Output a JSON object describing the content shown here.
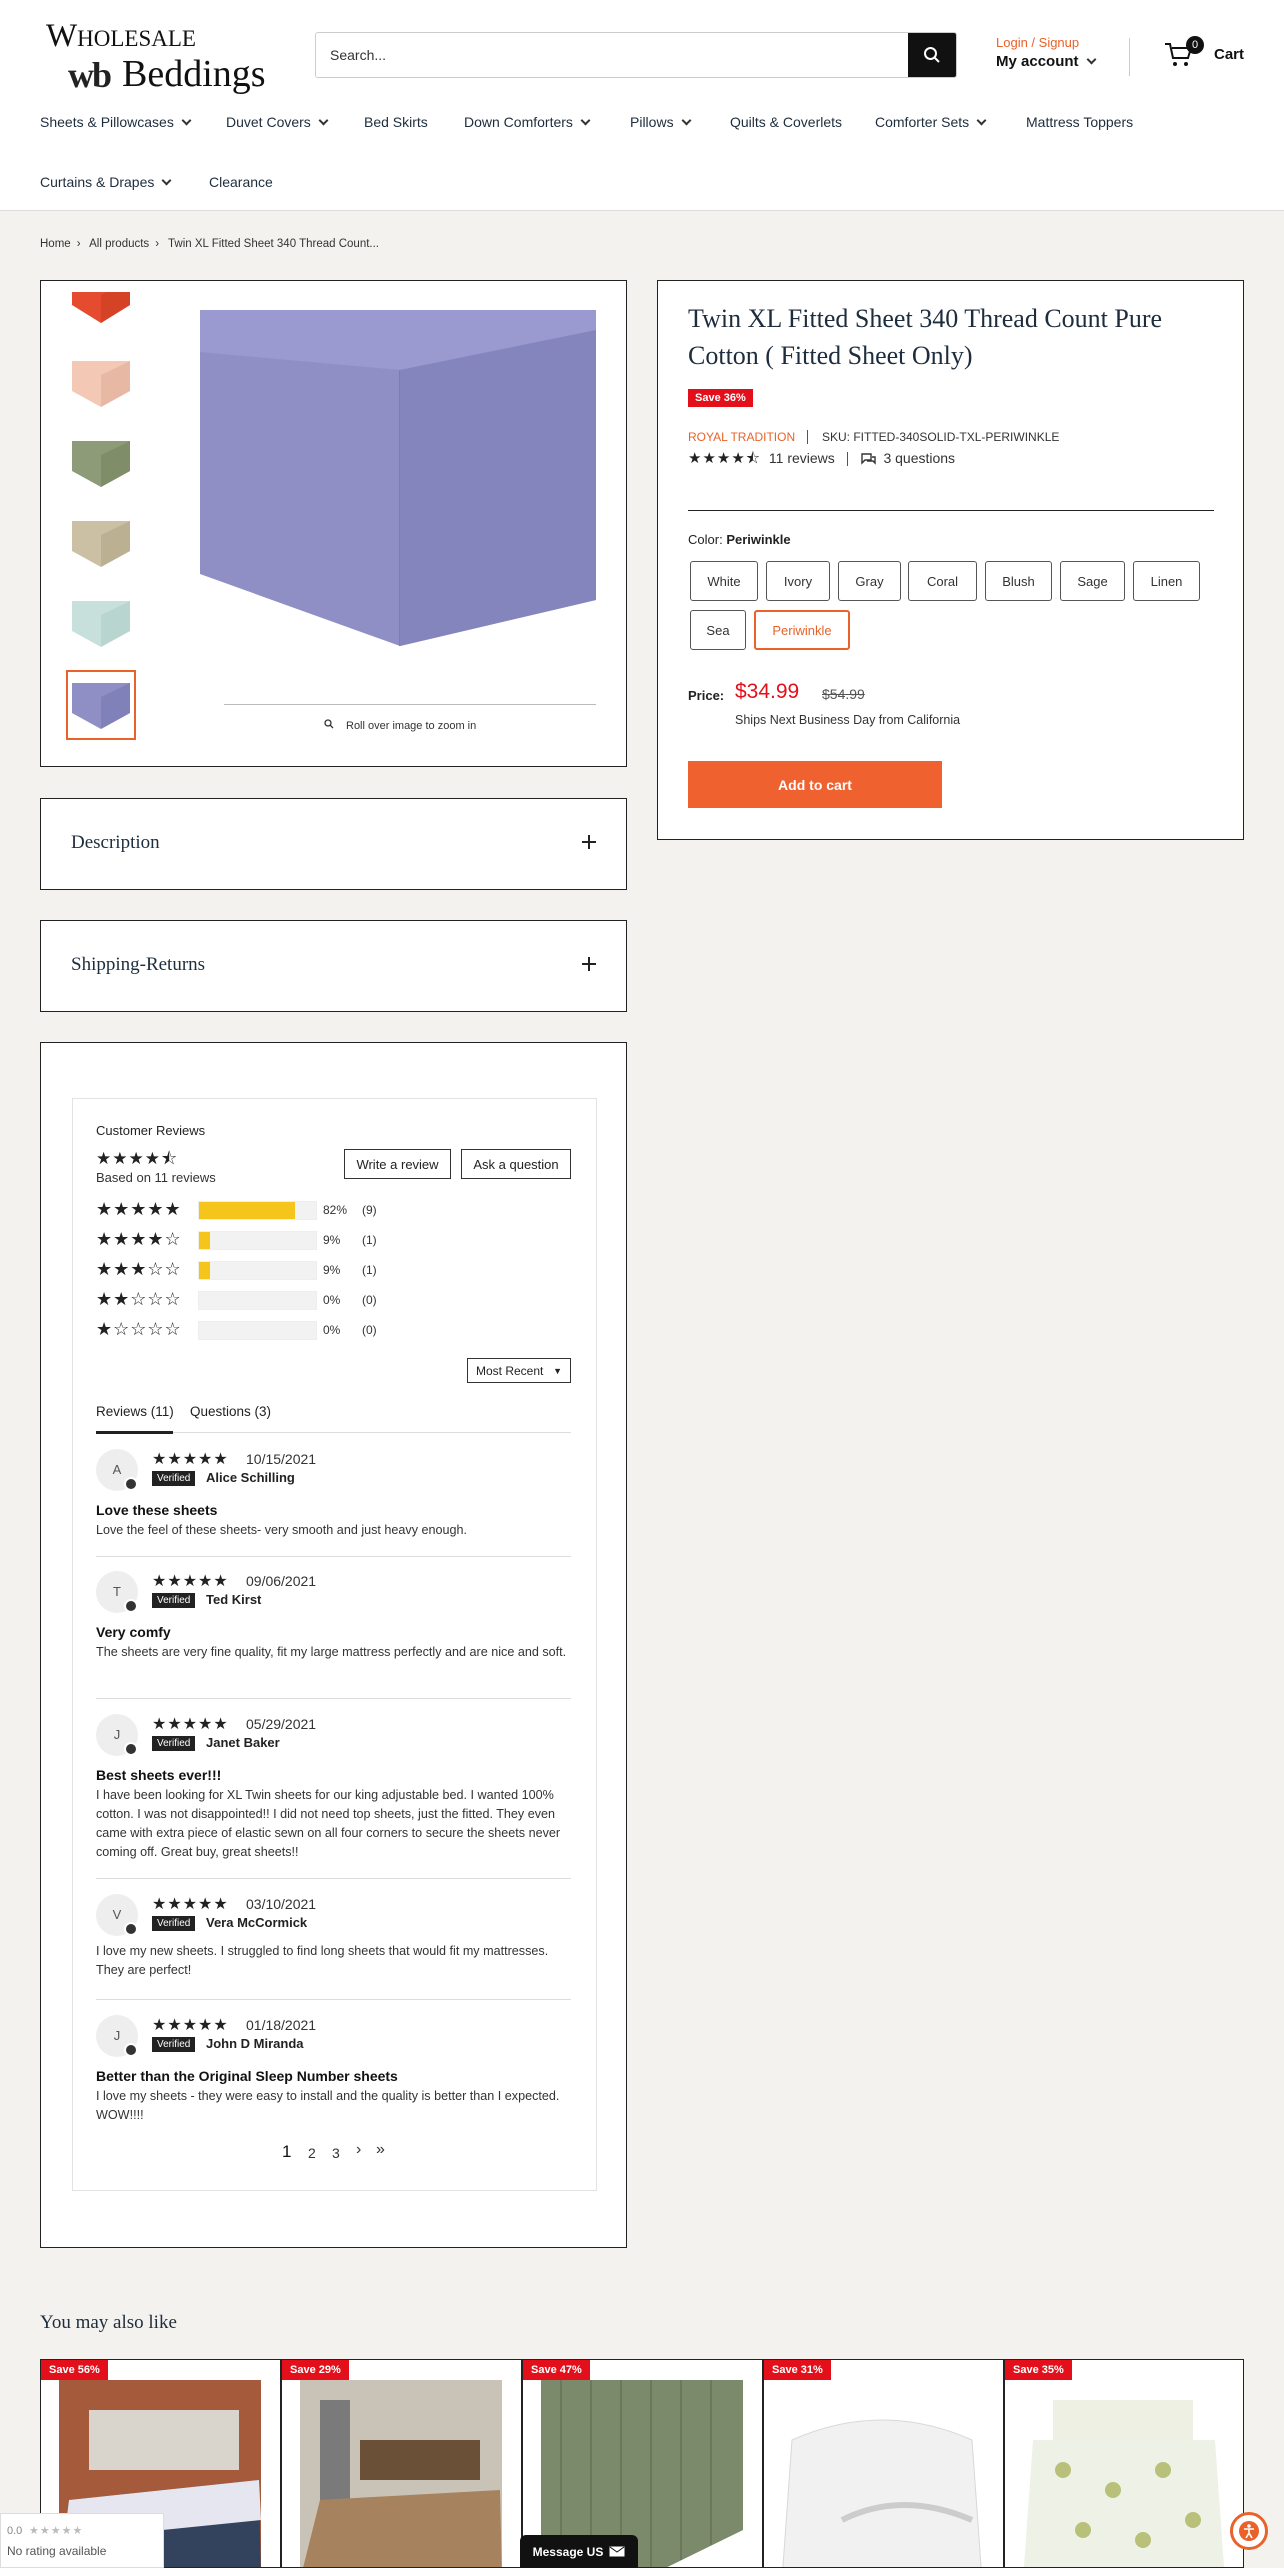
{
  "header": {
    "logo_line1": "Wholesale",
    "logo_mark": "wb",
    "logo_line2": "Beddings",
    "search_placeholder": "Search...",
    "login_label": "Login / Signup",
    "account_label": "My account",
    "cart_count": "0",
    "cart_label": "Cart"
  },
  "nav": [
    {
      "label": "Sheets & Pillowcases"
    },
    {
      "label": "Duvet Covers"
    },
    {
      "label": "Bed Skirts"
    },
    {
      "label": "Down Comforters"
    },
    {
      "label": "Pillows"
    },
    {
      "label": "Quilts & Coverlets"
    },
    {
      "label": "Comforter Sets"
    },
    {
      "label": "Mattress Toppers"
    },
    {
      "label": "Curtains & Drapes"
    },
    {
      "label": "Clearance"
    }
  ],
  "breadcrumb": {
    "home": "Home",
    "all": "All products",
    "current": "Twin XL Fitted Sheet 340 Thread Count..."
  },
  "gallery": {
    "zoom_hint": "Roll over image to zoom in",
    "thumb_colors": [
      "#e54b2f",
      "#f3c8b4",
      "#8d9b79",
      "#cbbfa4",
      "#c8e0dc",
      "#8f8fc6"
    ]
  },
  "product": {
    "title": "Twin XL Fitted Sheet 340 Thread Count Pure Cotton ( Fitted Sheet Only)",
    "save": "Save 36%",
    "vendor": "ROYAL TRADITION",
    "sku": "SKU: FITTED-340SOLID-TXL-PERIWINKLE",
    "rating_stars": "★★★★⯪",
    "reviews_link": "11 reviews",
    "questions_link": "3 questions",
    "color_label": "Color:",
    "color_value": "Periwinkle",
    "colors": [
      "White",
      "Ivory",
      "Gray",
      "Coral",
      "Blush",
      "Sage",
      "Linen",
      "Sea",
      "Periwinkle"
    ],
    "price_label": "Price:",
    "price": "$34.99",
    "compare_price": "$54.99",
    "shipping": "Ships Next Business Day from California",
    "add_to_cart": "Add to cart",
    "main_color": "#8f8fc6"
  },
  "accordions": {
    "description": "Description",
    "shipping": "Shipping-Returns"
  },
  "reviews": {
    "heading": "Customer Reviews",
    "summary_stars": "★★★★⯪",
    "based_on": "Based on 11 reviews",
    "write_review": "Write a review",
    "ask_question": "Ask a question",
    "histogram": [
      {
        "stars": "★★★★★",
        "percent": 82,
        "pct_label": "82%",
        "count": "(9)"
      },
      {
        "stars": "★★★★☆",
        "percent": 9,
        "pct_label": "9%",
        "count": "(1)"
      },
      {
        "stars": "★★★☆☆",
        "percent": 9,
        "pct_label": "9%",
        "count": "(1)"
      },
      {
        "stars": "★★☆☆☆",
        "percent": 0,
        "pct_label": "0%",
        "count": "(0)"
      },
      {
        "stars": "★☆☆☆☆",
        "percent": 0,
        "pct_label": "0%",
        "count": "(0)"
      }
    ],
    "sort": "Most Recent",
    "tab_reviews": "Reviews (11)",
    "tab_questions": "Questions (3)",
    "verified": "Verified",
    "items": [
      {
        "initial": "A",
        "stars": "★★★★★",
        "date": "10/15/2021",
        "name": "Alice Schilling",
        "title": "Love these sheets",
        "body": "Love the feel of these sheets- very smooth and just heavy enough."
      },
      {
        "initial": "T",
        "stars": "★★★★★",
        "date": "09/06/2021",
        "name": "Ted Kirst",
        "title": "Very comfy",
        "body": "The sheets are very fine quality, fit my large mattress perfectly and are nice and soft."
      },
      {
        "initial": "J",
        "stars": "★★★★★",
        "date": "05/29/2021",
        "name": "Janet Baker",
        "title": "Best sheets ever!!!",
        "body": "I have been looking for XL Twin sheets for our king adjustable bed. I wanted 100% cotton. I was not disappointed!! I did not need top sheets, just the fitted. They even came with extra piece of elastic sewn on all four corners to secure the sheets never coming off. Great buy, great sheets!!"
      },
      {
        "initial": "V",
        "stars": "★★★★★",
        "date": "03/10/2021",
        "name": "Vera McCormick",
        "title": "",
        "body": "I love my new sheets. I struggled to find long sheets that would fit my mattresses. They are perfect!"
      },
      {
        "initial": "J",
        "stars": "★★★★★",
        "date": "01/18/2021",
        "name": "John D Miranda",
        "title": "Better than the Original Sleep Number sheets",
        "body": "I love my sheets - they were easy to install and the quality is better than I expected. WOW!!!!"
      }
    ],
    "pages": [
      "1",
      "2",
      "3"
    ],
    "next": "›",
    "last": "»"
  },
  "related": {
    "heading": "You may also like",
    "items": [
      {
        "save": "Save 56%"
      },
      {
        "save": "Save 29%"
      },
      {
        "save": "Save 47%"
      },
      {
        "save": "Save 31%"
      },
      {
        "save": "Save 35%"
      }
    ]
  },
  "badges": {
    "google_rating": "0.0",
    "google_stars": "★★★★★",
    "google_text": "No rating available",
    "message": "Message US"
  }
}
